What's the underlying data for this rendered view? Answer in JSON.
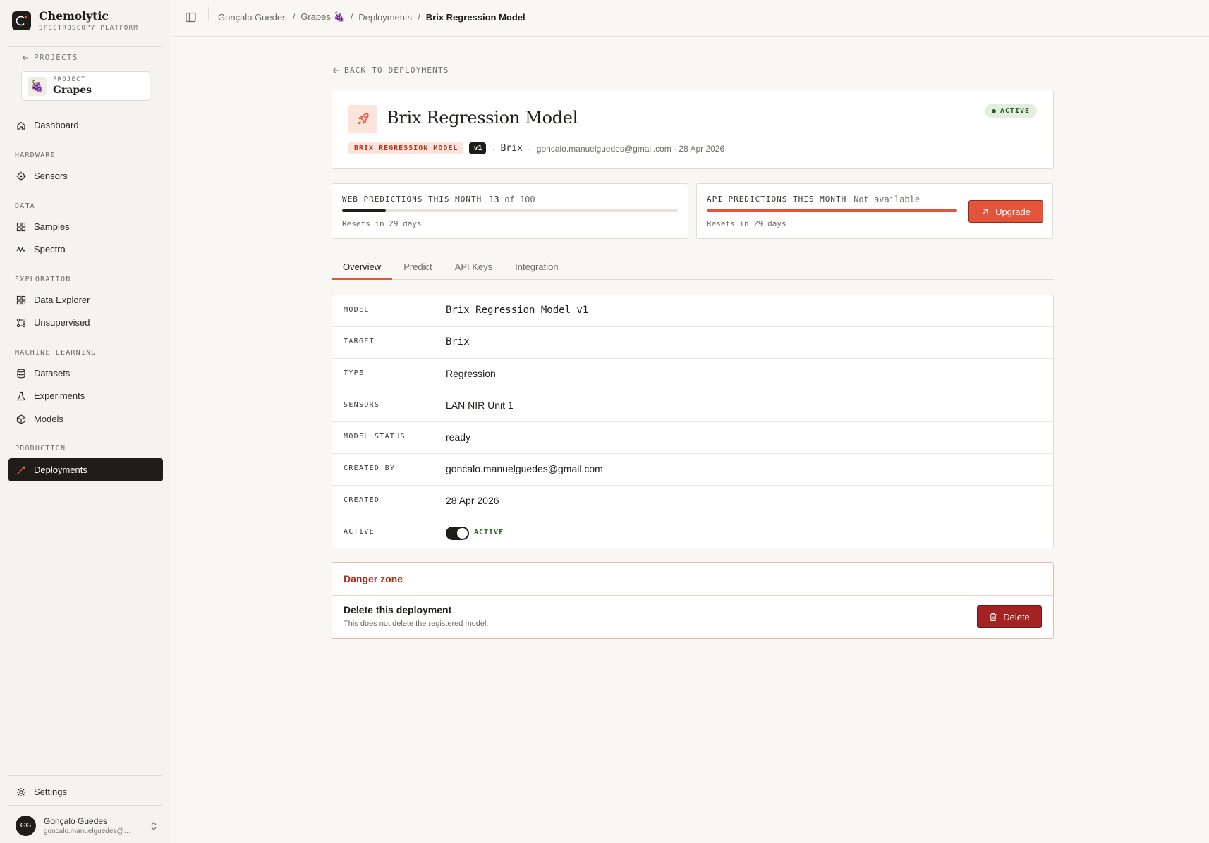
{
  "brand": {
    "name": "Chemolytic",
    "subtitle": "SPECTROSCOPY PLATFORM"
  },
  "sidebar": {
    "back_label": "PROJECTS",
    "project": {
      "kicker": "PROJECT",
      "name": "Grapes",
      "emoji": "🍇"
    },
    "dashboard": "Dashboard",
    "sections": {
      "hardware": "HARDWARE",
      "data": "DATA",
      "exploration": "EXPLORATION",
      "ml": "MACHINE LEARNING",
      "production": "PRODUCTION"
    },
    "items": {
      "sensors": "Sensors",
      "samples": "Samples",
      "spectra": "Spectra",
      "data_explorer": "Data Explorer",
      "unsupervised": "Unsupervised",
      "datasets": "Datasets",
      "experiments": "Experiments",
      "models": "Models",
      "deployments": "Deployments"
    },
    "settings": "Settings",
    "user": {
      "initials": "GG",
      "name": "Gonçalo Guedes",
      "email": "goncalo.manuelguedes@gmail.com"
    }
  },
  "breadcrumb": {
    "user": "Gonçalo Guedes",
    "project": "Grapes 🍇",
    "section": "Deployments",
    "current": "Brix Regression Model",
    "separator": "/"
  },
  "page": {
    "back_label": "BACK TO DEPLOYMENTS",
    "title": "Brix Regression Model",
    "status_badge": "ACTIVE",
    "tag_model": "BRIX REGRESSION MODEL",
    "tag_version": "v1",
    "target": "Brix",
    "dot": "·",
    "creator_date": "goncalo.manuelguedes@gmail.com · 28 Apr 2026"
  },
  "usage": {
    "web": {
      "label": "WEB PREDICTIONS THIS MONTH",
      "used": "13",
      "of_label": "of 100",
      "fraction": 0.13,
      "reset": "Resets in 29 days"
    },
    "api": {
      "label": "API PREDICTIONS THIS MONTH",
      "value": "Not available",
      "fraction": 1.0,
      "reset": "Resets in 29 days",
      "upgrade_label": "Upgrade"
    }
  },
  "tabs": [
    "Overview",
    "Predict",
    "API Keys",
    "Integration"
  ],
  "details": [
    {
      "key": "MODEL",
      "value": "Brix Regression Model v1",
      "mono": true
    },
    {
      "key": "TARGET",
      "value": "Brix",
      "mono": true
    },
    {
      "key": "TYPE",
      "value": "Regression"
    },
    {
      "key": "SENSORS",
      "value": "LAN NIR Unit 1"
    },
    {
      "key": "MODEL STATUS",
      "value": "ready"
    },
    {
      "key": "CREATED BY",
      "value": "goncalo.manuelguedes@gmail.com"
    },
    {
      "key": "CREATED",
      "value": "28 Apr 2026"
    },
    {
      "key": "ACTIVE",
      "toggle_label": "ACTIVE",
      "toggle_on": true
    }
  ],
  "danger": {
    "title": "Danger zone",
    "heading": "Delete this deployment",
    "description": "This does not delete the registered model.",
    "delete_label": "Delete"
  },
  "colors": {
    "accent": "#e2553b",
    "danger": "#a32323",
    "active_green": "#2d5a2a",
    "dark": "#1f1d1a"
  }
}
